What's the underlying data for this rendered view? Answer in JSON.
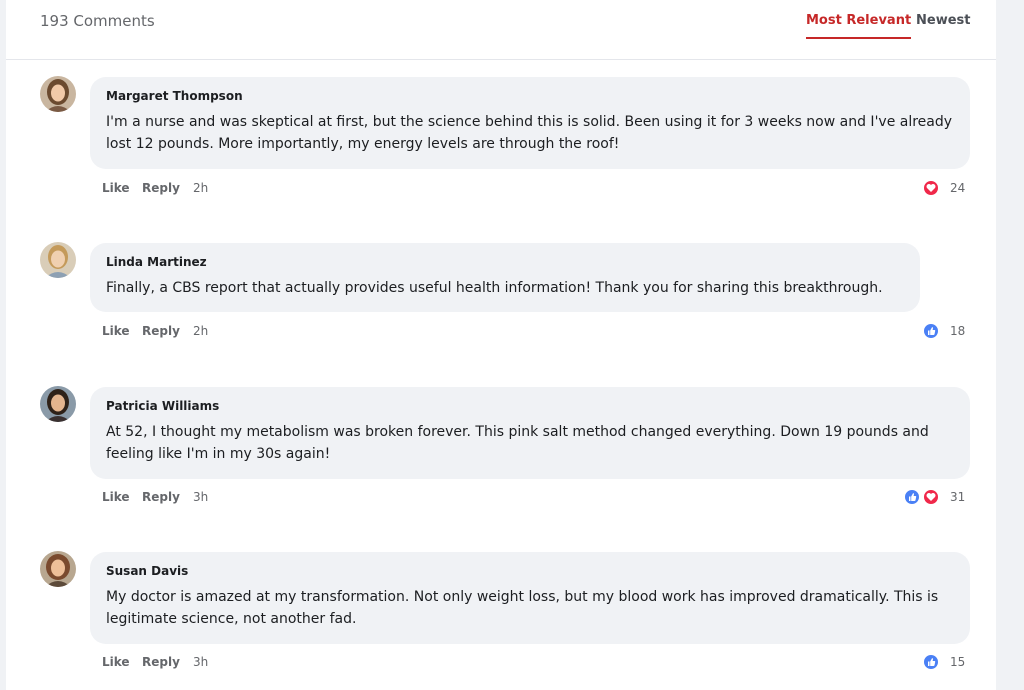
{
  "header": {
    "count": "193 Comments",
    "sort_most_relevant": "Most Relevant",
    "sort_newest": "Newest"
  },
  "comments": [
    {
      "name": "Margaret Thompson",
      "text": "I'm a nurse and was skeptical at first, but the science behind this is solid. Been using it for 3 weeks now and I've already lost 12 pounds. More importantly, my energy levels are through the roof!",
      "like": "Like",
      "reply": "Reply",
      "time": "2h",
      "reactions": [
        "love"
      ],
      "reaction_count": "24"
    },
    {
      "name": "Linda Martinez",
      "text": "Finally, a CBS report that actually provides useful health information! Thank you for sharing this breakthrough.",
      "like": "Like",
      "reply": "Reply",
      "time": "2h",
      "reactions": [
        "like"
      ],
      "reaction_count": "18"
    },
    {
      "name": "Patricia Williams",
      "text": "At 52, I thought my metabolism was broken forever. This pink salt method changed everything. Down 19 pounds and feeling like I'm in my 30s again!",
      "like": "Like",
      "reply": "Reply",
      "time": "3h",
      "reactions": [
        "like",
        "love"
      ],
      "reaction_count": "31"
    },
    {
      "name": "Susan Davis",
      "text": "My doctor is amazed at my transformation. Not only weight loss, but my blood work has improved dramatically. This is legitimate science, not another fad.",
      "like": "Like",
      "reply": "Reply",
      "time": "3h",
      "reactions": [
        "like"
      ],
      "reaction_count": "15"
    }
  ],
  "colors": {
    "accent": "#c62828",
    "like_blue": "#4a80f5",
    "love_red": "#f0284a",
    "bubble": "#f0f2f5"
  }
}
